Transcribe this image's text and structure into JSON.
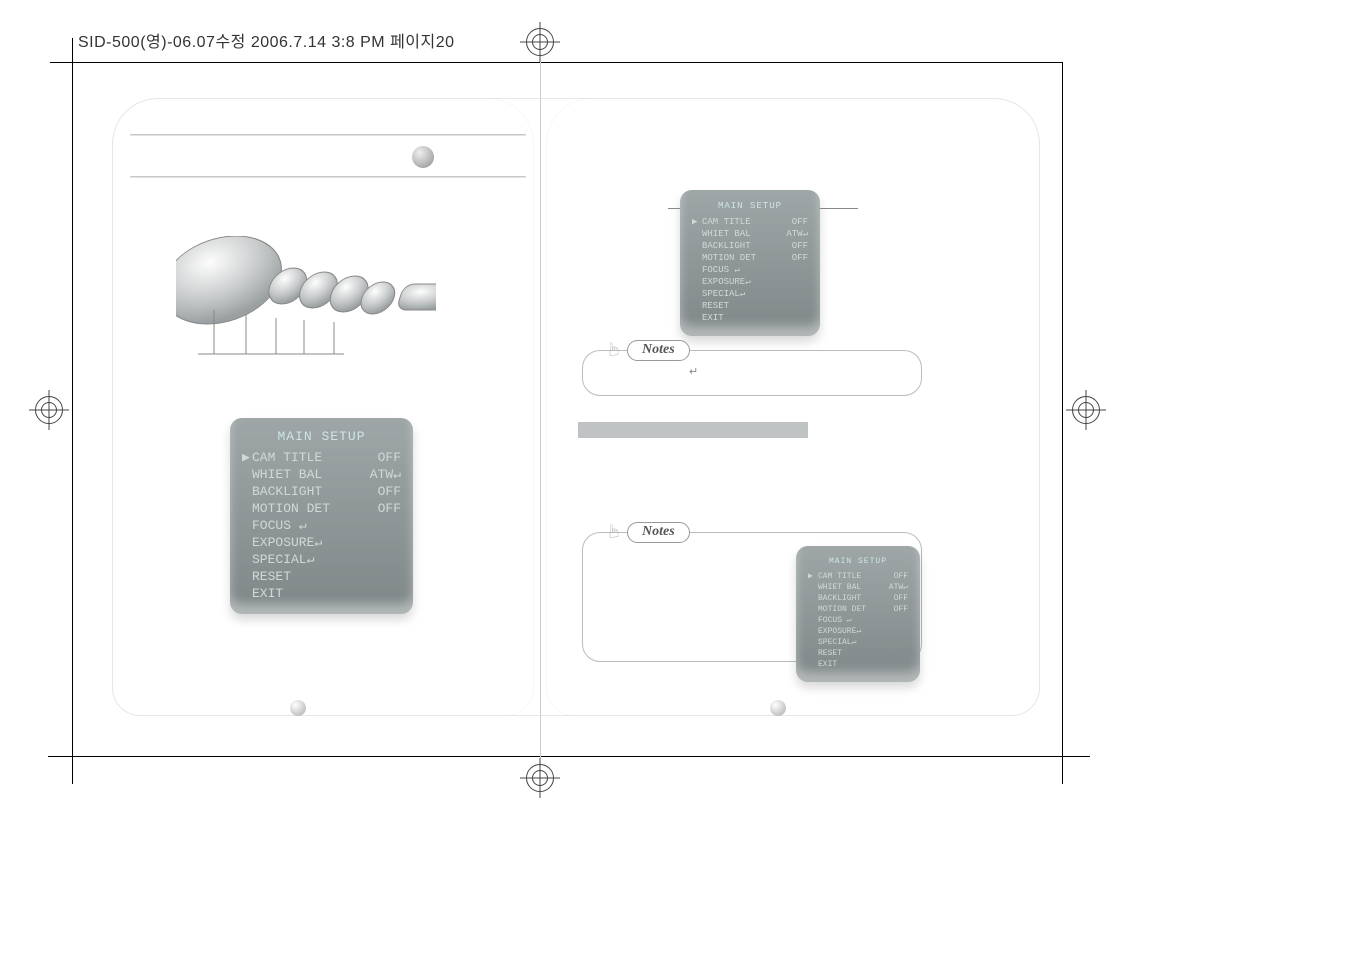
{
  "print_header": "SID-500(영)-06.07수정  2006.7.14 3:8 PM  페이지20",
  "notes_label": "Notes",
  "enter_symbol": "↵",
  "menu": {
    "title": "MAIN SETUP",
    "items": [
      {
        "label": "CAM TITLE",
        "value": "OFF",
        "pointer": "▶"
      },
      {
        "label": "WHIET BAL",
        "value": "ATW↵"
      },
      {
        "label": "BACKLIGHT",
        "value": "OFF"
      },
      {
        "label": "MOTION DET",
        "value": "OFF"
      },
      {
        "label": "FOCUS ↵",
        "value": ""
      },
      {
        "label": "EXPOSURE↵",
        "value": ""
      },
      {
        "label": "SPECIAL↵",
        "value": ""
      },
      {
        "label": "RESET",
        "value": ""
      },
      {
        "label": "EXIT",
        "value": ""
      }
    ]
  }
}
